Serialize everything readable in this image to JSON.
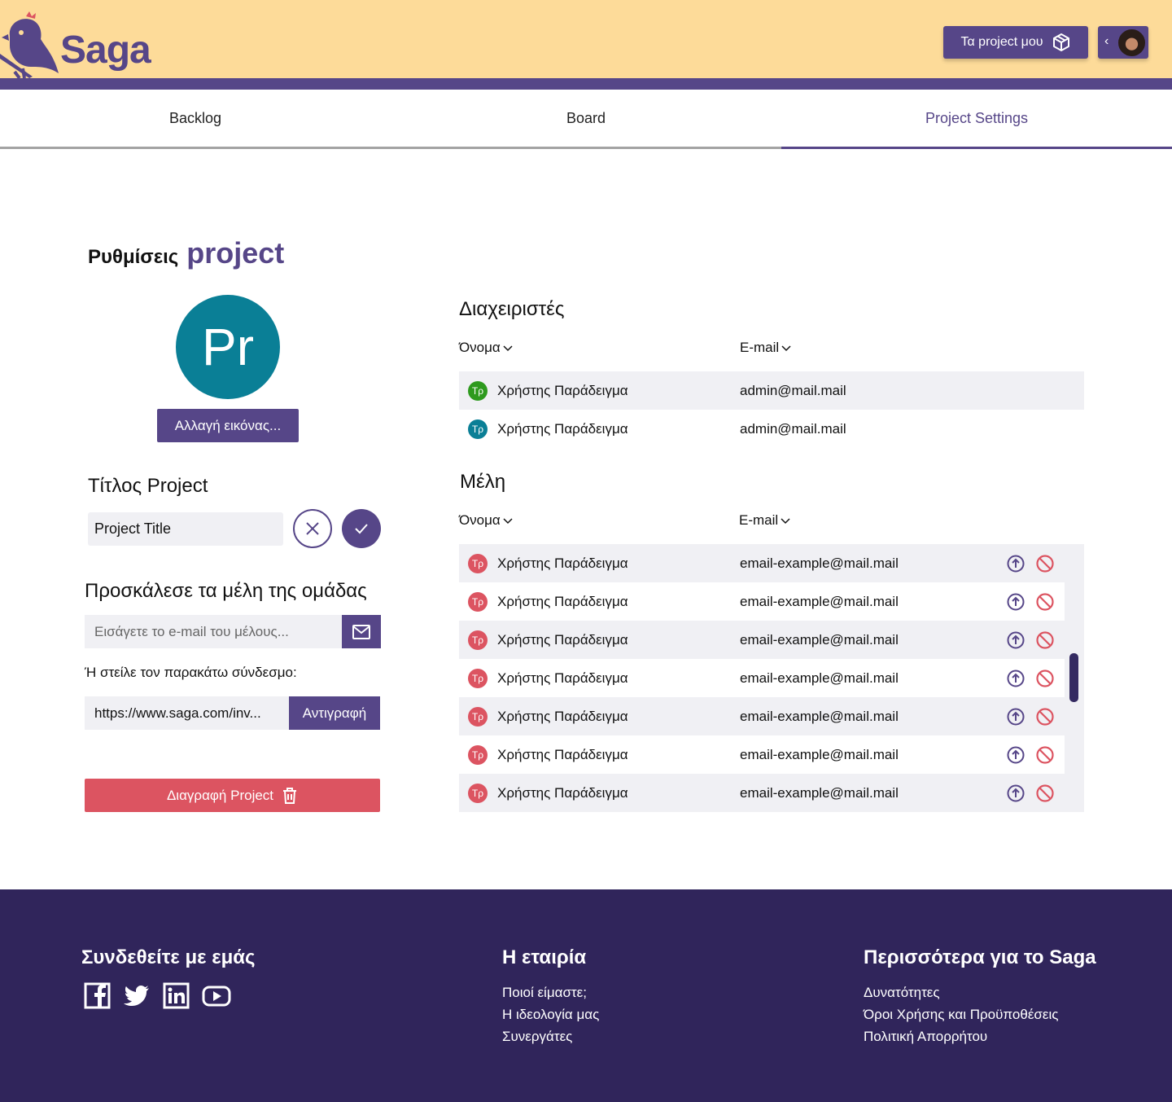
{
  "header": {
    "logo_text": "Saga",
    "my_projects_label": "Τα project μου"
  },
  "tabs": [
    {
      "label": "Backlog",
      "active": false
    },
    {
      "label": "Board",
      "active": false
    },
    {
      "label": "Project Settings",
      "active": true
    }
  ],
  "settings": {
    "title_prefix": "Ρυθμίσεις",
    "title_main": "project",
    "avatar_initials": "Pr",
    "change_image_label": "Αλλαγή εικόνας...",
    "project_title_label": "Τίτλος Project",
    "project_title_value": "Project Title",
    "invite_heading": "Προσκάλεσε τα μέλη της ομάδας",
    "invite_placeholder": "Εισάγετε το e-mail του μέλους...",
    "or_send_label": "Ή στείλε τον παρακάτω σύνδεσμο:",
    "invite_link": "https://www.saga.com/inv...",
    "copy_label": "Αντιγραφή",
    "delete_label": "Διαγραφή Project"
  },
  "admins": {
    "heading": "Διαχειριστές",
    "col_name": "Όνομα",
    "col_email": "E-mail",
    "rows": [
      {
        "initials": "Τρ",
        "name": "Χρήστης Παράδειγμα",
        "email": "admin@mail.mail",
        "color": "#2e9a1e"
      },
      {
        "initials": "Τρ",
        "name": "Χρήστης Παράδειγμα",
        "email": "admin@mail.mail",
        "color": "#0a7f96"
      }
    ]
  },
  "members": {
    "heading": "Μέλη",
    "col_name": "Όνομα",
    "col_email": "E-mail",
    "rows": [
      {
        "initials": "Τρ",
        "name": "Χρήστης Παράδειγμα",
        "email": "email-example@mail.mail"
      },
      {
        "initials": "Τρ",
        "name": "Χρήστης Παράδειγμα",
        "email": "email-example@mail.mail"
      },
      {
        "initials": "Τρ",
        "name": "Χρήστης Παράδειγμα",
        "email": "email-example@mail.mail"
      },
      {
        "initials": "Τρ",
        "name": "Χρήστης Παράδειγμα",
        "email": "email-example@mail.mail"
      },
      {
        "initials": "Τρ",
        "name": "Χρήστης Παράδειγμα",
        "email": "email-example@mail.mail"
      },
      {
        "initials": "Τρ",
        "name": "Χρήστης Παράδειγμα",
        "email": "email-example@mail.mail"
      },
      {
        "initials": "Τρ",
        "name": "Χρήστης Παράδειγμα",
        "email": "email-example@mail.mail"
      }
    ],
    "member_color": "#dc5461"
  },
  "footer": {
    "connect_heading": "Συνδεθείτε με εμάς",
    "company_heading": "Η εταιρία",
    "company_links": [
      "Ποιοί είμαστε;",
      "Η ιδεολογία μας",
      "Συνεργάτες"
    ],
    "more_heading": "Περισσότερα για το Saga",
    "more_links": [
      "Δυνατότητες",
      "Όροι Χρήσης και Προϋποθέσεις",
      "Πολιτική Απορρήτου"
    ],
    "social_icons": [
      "facebook-icon",
      "twitter-icon",
      "linkedin-icon",
      "youtube-icon"
    ]
  },
  "colors": {
    "brand": "#564688",
    "header_bg": "#fddb99",
    "footer_bg": "#30255b",
    "danger": "#dc5461"
  }
}
